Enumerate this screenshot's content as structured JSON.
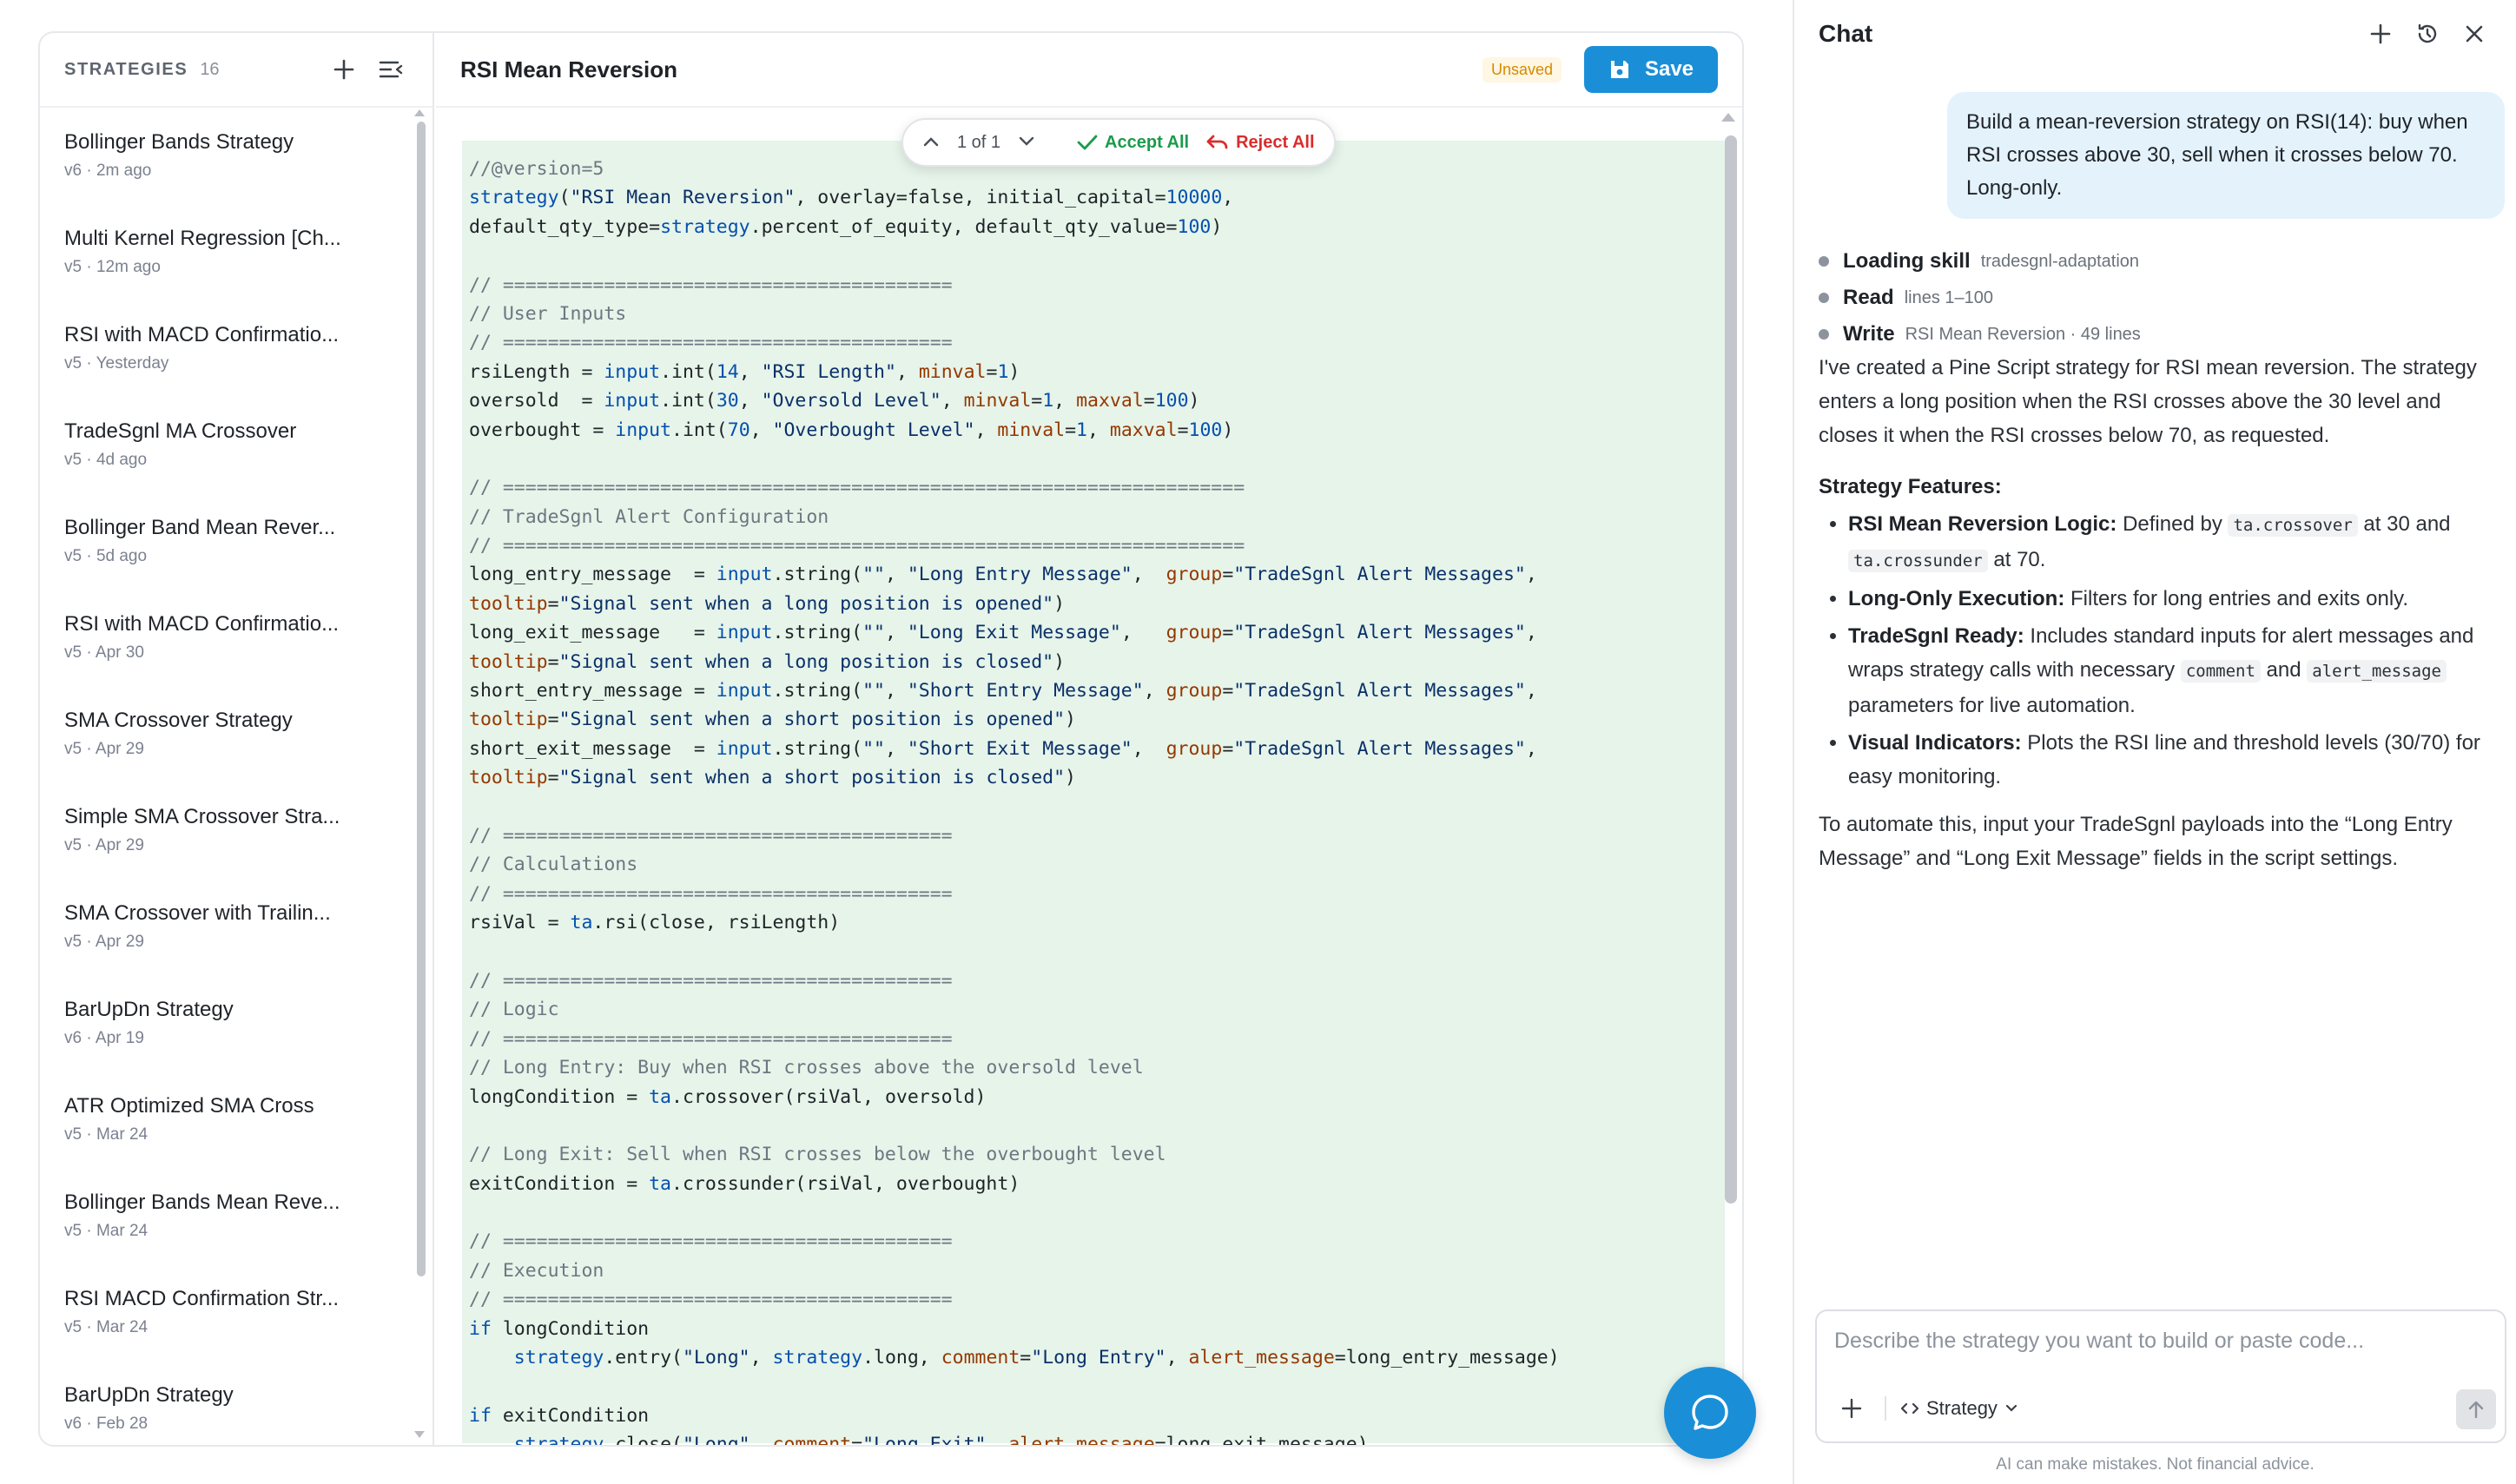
{
  "sidebar": {
    "title": "STRATEGIES",
    "count": "16",
    "items": [
      {
        "name": "Bollinger Bands Strategy",
        "meta": "v6 · 2m ago"
      },
      {
        "name": "Multi Kernel Regression [Ch...",
        "meta": "v5 · 12m ago"
      },
      {
        "name": "RSI with MACD Confirmatio...",
        "meta": "v5 · Yesterday"
      },
      {
        "name": "TradeSgnl MA Crossover",
        "meta": "v5 · 4d ago"
      },
      {
        "name": "Bollinger Band Mean Rever...",
        "meta": "v5 · 5d ago"
      },
      {
        "name": "RSI with MACD Confirmatio...",
        "meta": "v5 · Apr 30"
      },
      {
        "name": "SMA Crossover Strategy",
        "meta": "v5 · Apr 29"
      },
      {
        "name": "Simple SMA Crossover Stra...",
        "meta": "v5 · Apr 29"
      },
      {
        "name": "SMA Crossover with Trailin...",
        "meta": "v5 · Apr 29"
      },
      {
        "name": "BarUpDn Strategy",
        "meta": "v6 · Apr 19"
      },
      {
        "name": "ATR Optimized SMA Cross",
        "meta": "v5 · Mar 24"
      },
      {
        "name": "Bollinger Bands Mean Reve...",
        "meta": "v5 · Mar 24"
      },
      {
        "name": "RSI MACD Confirmation Str...",
        "meta": "v5 · Mar 24"
      },
      {
        "name": "BarUpDn Strategy",
        "meta": "v6 · Feb 28"
      }
    ]
  },
  "editor": {
    "title": "RSI Mean Reversion",
    "unsaved": "Unsaved",
    "save_label": "Save",
    "diff": {
      "counter": "1 of 1",
      "accept": "Accept All",
      "reject": "Reject All"
    },
    "code_lines": [
      "//@version=5",
      "strategy(\"RSI Mean Reversion\", overlay=false, initial_capital=10000,",
      "default_qty_type=strategy.percent_of_equity, default_qty_value=100)",
      "",
      "// ========================================",
      "// User Inputs",
      "// ========================================",
      "rsiLength = input.int(14, \"RSI Length\", minval=1)",
      "oversold  = input.int(30, \"Oversold Level\", minval=1, maxval=100)",
      "overbought = input.int(70, \"Overbought Level\", minval=1, maxval=100)",
      "",
      "// ==================================================================",
      "// TradeSgnl Alert Configuration",
      "// ==================================================================",
      "long_entry_message  = input.string(\"\", \"Long Entry Message\",  group=\"TradeSgnl Alert Messages\",",
      "tooltip=\"Signal sent when a long position is opened\")",
      "long_exit_message   = input.string(\"\", \"Long Exit Message\",   group=\"TradeSgnl Alert Messages\",",
      "tooltip=\"Signal sent when a long position is closed\")",
      "short_entry_message = input.string(\"\", \"Short Entry Message\", group=\"TradeSgnl Alert Messages\",",
      "tooltip=\"Signal sent when a short position is opened\")",
      "short_exit_message  = input.string(\"\", \"Short Exit Message\",  group=\"TradeSgnl Alert Messages\",",
      "tooltip=\"Signal sent when a short position is closed\")",
      "",
      "// ========================================",
      "// Calculations",
      "// ========================================",
      "rsiVal = ta.rsi(close, rsiLength)",
      "",
      "// ========================================",
      "// Logic",
      "// ========================================",
      "// Long Entry: Buy when RSI crosses above the oversold level",
      "longCondition = ta.crossover(rsiVal, oversold)",
      "",
      "// Long Exit: Sell when RSI crosses below the overbought level",
      "exitCondition = ta.crossunder(rsiVal, overbought)",
      "",
      "// ========================================",
      "// Execution",
      "// ========================================",
      "if longCondition",
      "    strategy.entry(\"Long\", strategy.long, comment=\"Long Entry\", alert_message=long_entry_message)",
      "",
      "if exitCondition",
      "    strategy.close(\"Long\", comment=\"Long Exit\", alert_message=long_exit_message)"
    ]
  },
  "chat": {
    "title": "Chat",
    "user_message": "Build a mean-reversion strategy on RSI(14): buy when RSI crosses above 30, sell when it crosses below 70. Long-only.",
    "activity": [
      {
        "label": "Loading skill",
        "detail": "tradesgnl-adaptation"
      },
      {
        "label": "Read",
        "detail": "lines 1–100"
      },
      {
        "label": "Write",
        "detail": "RSI Mean Reversion · 49 lines"
      }
    ],
    "intro": "I've created a Pine Script strategy for RSI mean reversion. The strategy enters a long position when the RSI crosses above the 30 level and closes it when the RSI crosses below 70, as requested.",
    "features_heading": "Strategy Features:",
    "features": [
      {
        "title": "RSI Mean Reversion Logic:",
        "t1": " Defined by ",
        "c1": "ta.crossover",
        "t2": " at 30 and ",
        "c2": "ta.crossunder",
        "t3": " at 70."
      },
      {
        "title": "Long-Only Execution:",
        "t1": " Filters for long entries and exits only."
      },
      {
        "title": "TradeSgnl Ready:",
        "t1": " Includes standard inputs for alert messages and wraps strategy calls with necessary ",
        "c1": "comment",
        "t2": " and ",
        "c2": "alert_message",
        "t3": " parameters for live automation."
      },
      {
        "title": "Visual Indicators:",
        "t1": " Plots the RSI line and threshold levels (30/70) for easy monitoring."
      }
    ],
    "closing": "To automate this, input your TradeSgnl payloads into the “Long Entry Message” and “Long Exit Message” fields in the script settings.",
    "composer_placeholder": "Describe the strategy you want to build or paste code...",
    "mode_label": "Strategy",
    "disclaimer": "AI can make mistakes. Not financial advice."
  },
  "colors": {
    "accent": "#1a8fd8",
    "diff_bg": "#e6f4ea",
    "accept": "#1a9b4b",
    "reject": "#d92d2d",
    "unsaved": "#d68a00"
  },
  "icons": [
    "plus-icon",
    "collapse-list-icon",
    "save-disk-icon",
    "chevron-up-icon",
    "chevron-down-icon",
    "check-icon",
    "undo-icon",
    "history-icon",
    "close-icon",
    "code-icon",
    "arrow-up-icon",
    "chat-bubble-icon"
  ]
}
